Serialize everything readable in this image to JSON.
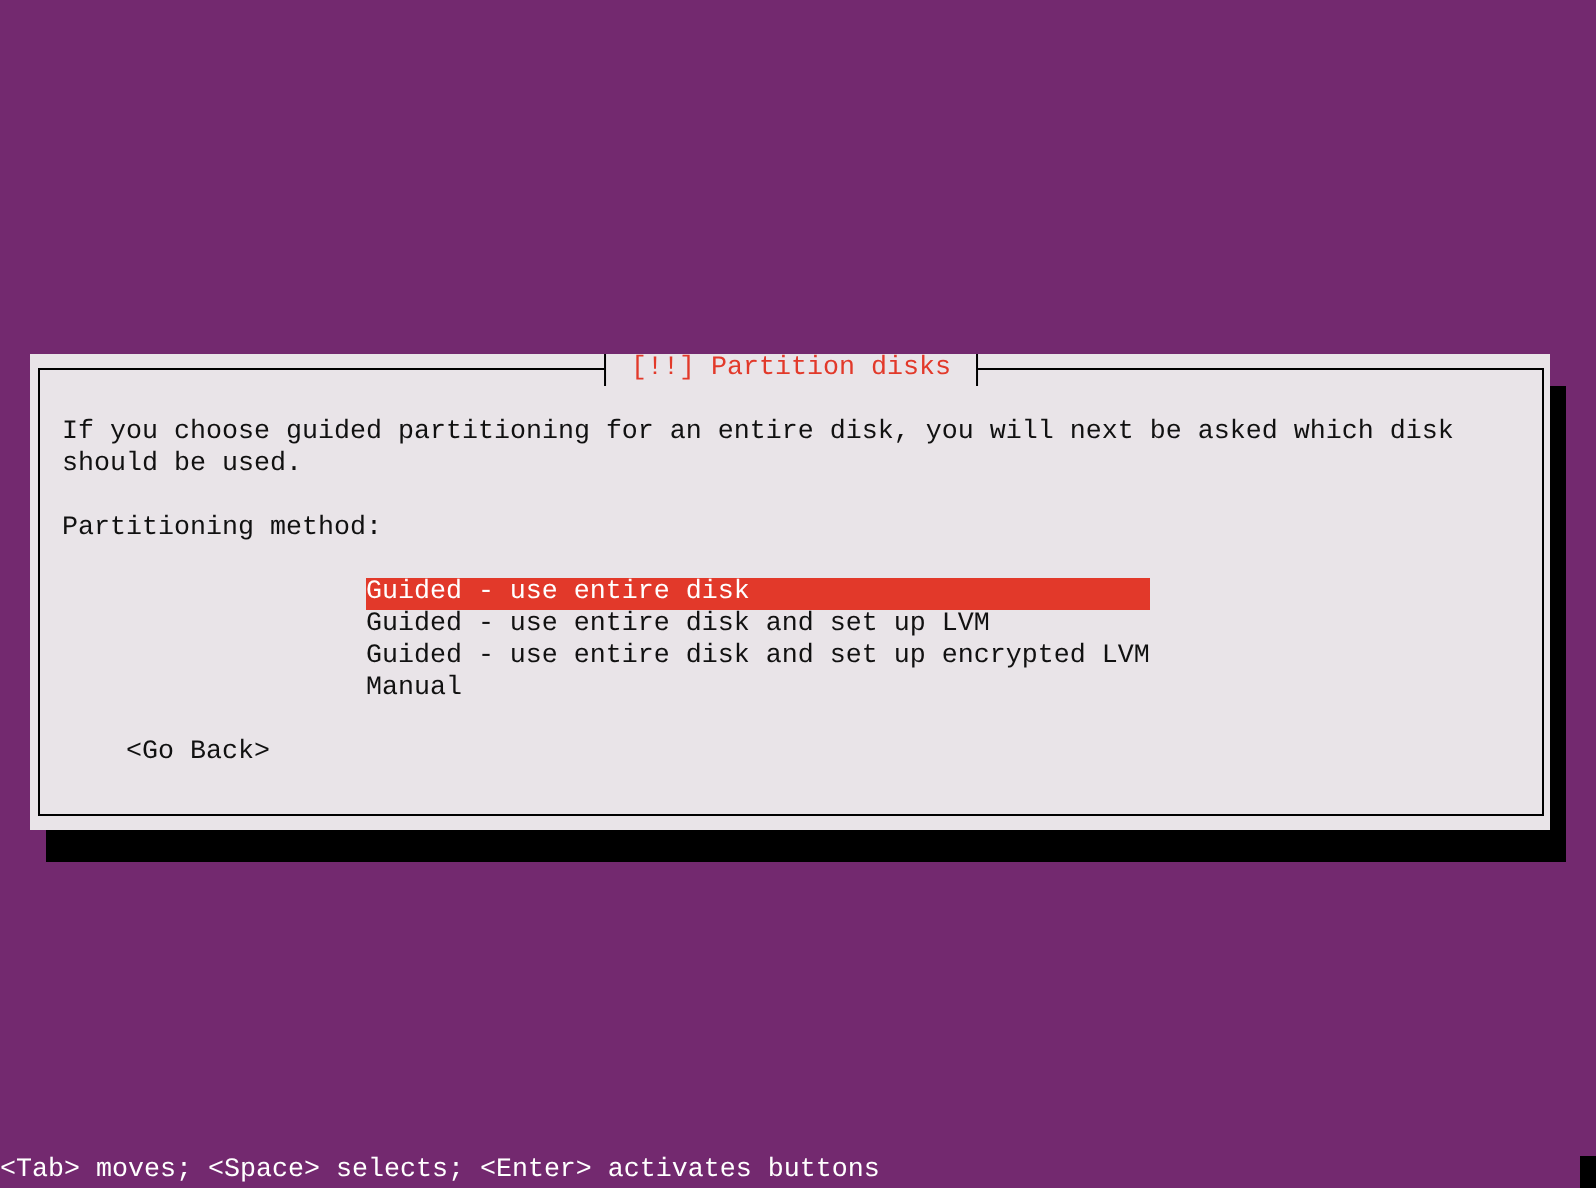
{
  "dialog": {
    "title": "[!!] Partition disks",
    "message": "If you choose guided partitioning for an entire disk, you will next be asked which disk should be used.",
    "prompt": "Partitioning method:",
    "options": [
      {
        "label": "Guided - use entire disk",
        "selected": true
      },
      {
        "label": "Guided - use entire disk and set up LVM",
        "selected": false
      },
      {
        "label": "Guided - use entire disk and set up encrypted LVM",
        "selected": false
      },
      {
        "label": "Manual",
        "selected": false
      }
    ],
    "buttons": [
      {
        "label": "<Go Back>"
      }
    ]
  },
  "status_bar": "<Tab> moves; <Space> selects; <Enter> activates buttons"
}
